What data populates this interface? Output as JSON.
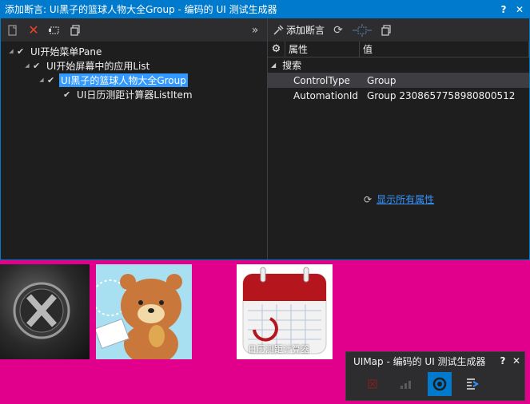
{
  "dialog": {
    "title": "添加断言: UI黑子的篮球人物大全Group - 编码的 UI 测试生成器",
    "help": "?",
    "close": "✕"
  },
  "left_toolbar": {
    "new_icon": "new-icon",
    "delete_icon": "delete-icon",
    "select_icon": "select-icon",
    "copy_icon": "copy-icon",
    "expand": "»"
  },
  "tree": {
    "items": [
      {
        "label": "UI开始菜单Pane",
        "level": 0
      },
      {
        "label": "UI开始屏幕中的应用List",
        "level": 1
      },
      {
        "label": "UI黑子的篮球人物大全Group",
        "level": 2,
        "selected": true
      },
      {
        "label": "UI日历测距计算器ListItem",
        "level": 3
      }
    ]
  },
  "right_toolbar": {
    "add_assert_label": "添加断言"
  },
  "properties": {
    "col_name": "属性",
    "col_value": "值",
    "category": "搜索",
    "rows": [
      {
        "name": "ControlType",
        "value": "Group"
      },
      {
        "name": "AutomationId",
        "value": "Group 2308657758980800512"
      }
    ],
    "show_all": "显示所有属性"
  },
  "desktop": {
    "calendar_caption": "日历测距计算器"
  },
  "uimap": {
    "title": "UIMap - 编码的 UI 测试生成器",
    "help": "?",
    "close": "✕"
  },
  "colors": {
    "accent": "#007acc",
    "desktop": "#e0008c",
    "selection": "#3399ff",
    "link": "#3794ff"
  }
}
